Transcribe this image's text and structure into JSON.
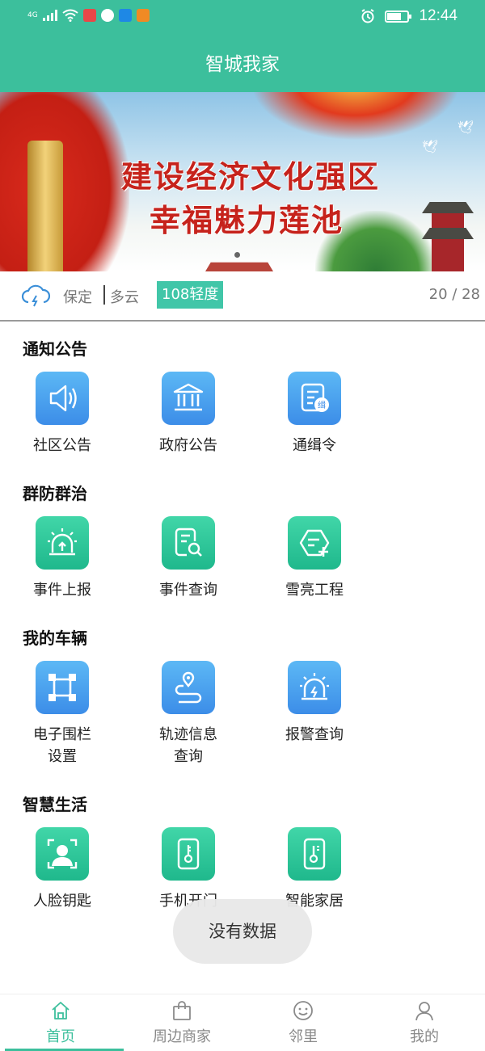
{
  "status_bar": {
    "network": "4G",
    "time": "12:44",
    "icons": [
      "signal-icon",
      "wifi-icon",
      "reader-app-icon",
      "chat-app-icon",
      "browser-app-icon",
      "video-app-icon",
      "alarm-icon",
      "battery-icon"
    ]
  },
  "header": {
    "title": "智城我家"
  },
  "banner": {
    "line1": "建设经济文化强区",
    "line2": "幸福魅力莲池"
  },
  "info": {
    "city": "保定",
    "weather": "多云",
    "aqi": "108轻度",
    "pager": "20 / 28"
  },
  "sections": [
    {
      "title": "通知公告",
      "items": [
        {
          "label": "社区公告",
          "icon": "speaker-icon"
        },
        {
          "label": "政府公告",
          "icon": "government-building-icon"
        },
        {
          "label": "通缉令",
          "icon": "wanted-notice-icon"
        }
      ]
    },
    {
      "title": "群防群治",
      "items": [
        {
          "label": "事件上报",
          "icon": "alarm-report-icon"
        },
        {
          "label": "事件查询",
          "icon": "document-search-icon"
        },
        {
          "label": "雪亮工程",
          "icon": "shield-add-icon"
        }
      ]
    },
    {
      "title": "我的车辆",
      "items": [
        {
          "label": "电子围栏\n设置",
          "icon": "fence-icon"
        },
        {
          "label": "轨迹信息\n查询",
          "icon": "route-pin-icon"
        },
        {
          "label": "报警查询",
          "icon": "alarm-light-icon"
        }
      ]
    },
    {
      "title": "智慧生活",
      "items": [
        {
          "label": "人脸钥匙",
          "icon": "face-scan-icon"
        },
        {
          "label": "手机开门",
          "icon": "phone-key-icon"
        },
        {
          "label": "智能家居",
          "icon": "phone-thermometer-icon"
        }
      ]
    }
  ],
  "toast": "没有数据",
  "tabs": [
    {
      "label": "首页",
      "icon": "home-icon",
      "active": true
    },
    {
      "label": "周边商家",
      "icon": "shopping-bag-icon",
      "active": false
    },
    {
      "label": "邻里",
      "icon": "smile-icon",
      "active": false
    },
    {
      "label": "我的",
      "icon": "person-icon",
      "active": false
    }
  ],
  "colors": {
    "accent": "#3cbf9c",
    "tile_blue": "#4aa3ee",
    "tile_green": "#2cc597"
  }
}
